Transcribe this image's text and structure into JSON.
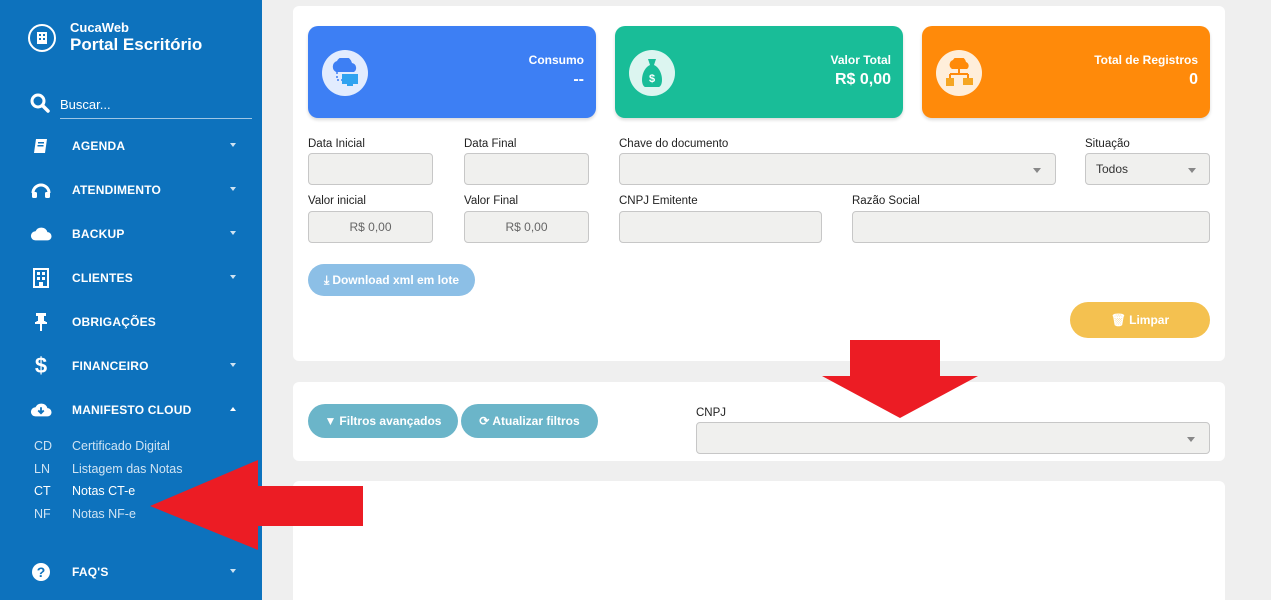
{
  "sidebar": {
    "brand_small": "CucaWeb",
    "brand_big": "Portal Escritório",
    "search_placeholder": "Buscar...",
    "items": [
      {
        "label": "AGENDA",
        "icon": "book-icon",
        "caret": "down"
      },
      {
        "label": "ATENDIMENTO",
        "icon": "headset-icon",
        "caret": "down"
      },
      {
        "label": "BACKUP",
        "icon": "cloud-icon",
        "caret": "down"
      },
      {
        "label": "CLIENTES",
        "icon": "building-icon",
        "caret": "down"
      },
      {
        "label": "OBRIGAÇÕES",
        "icon": "pin-icon",
        "caret": ""
      },
      {
        "label": "FINANCEIRO",
        "icon": "dollar-icon",
        "caret": "down"
      },
      {
        "label": "MANIFESTO CLOUD",
        "icon": "cloud-download-icon",
        "caret": "up"
      },
      {
        "label": "FAQ'S",
        "icon": "question-icon",
        "caret": "down"
      }
    ],
    "submenu": [
      {
        "abbr": "CD",
        "label": "Certificado Digital"
      },
      {
        "abbr": "LN",
        "label": "Listagem das Notas"
      },
      {
        "abbr": "CT",
        "label": "Notas CT-e",
        "active": true
      },
      {
        "abbr": "NF",
        "label": "Notas NF-e"
      }
    ]
  },
  "cards": [
    {
      "title": "Consumo",
      "value": "--",
      "color": "#3d7ff4",
      "icon": "cloud-computer-icon"
    },
    {
      "title": "Valor Total",
      "value": "R$ 0,00",
      "color": "#19bd98",
      "icon": "money-bag-icon"
    },
    {
      "title": "Total de Registros",
      "value": "0",
      "color": "#ff8a0a",
      "icon": "network-icon"
    }
  ],
  "filters": {
    "data_inicial": "Data Inicial",
    "data_final": "Data Final",
    "chave": "Chave do documento",
    "situacao": "Situação",
    "situacao_value": "Todos",
    "valor_inicial": "Valor inicial",
    "valor_inicial_value": "R$ 0,00",
    "valor_final": "Valor Final",
    "valor_final_value": "R$ 0,00",
    "cnpj_emitente": "CNPJ Emitente",
    "razao_social": "Razão Social",
    "download_btn": "Download xml em lote",
    "limpar_btn": "Limpar"
  },
  "advanced": {
    "filtros_btn": "Filtros avançados",
    "atualizar_btn": "Atualizar filtros",
    "cnpj_label": "CNPJ"
  },
  "colors": {
    "sidebar": "#0d72bd",
    "arrow": "#ec1c24",
    "download_btn": "#8cbfe6",
    "limpar_btn": "#f4c150",
    "filter_btn": "#6bb5c9"
  }
}
